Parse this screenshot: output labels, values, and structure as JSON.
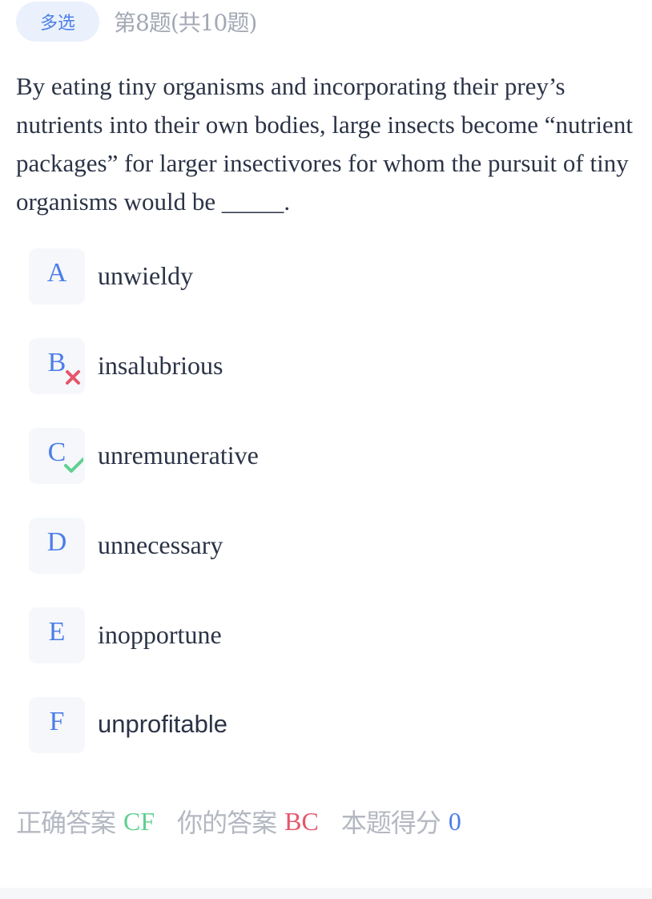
{
  "header": {
    "question_type": "多选",
    "progress": "第8题(共10题)"
  },
  "question": {
    "text": "By eating tiny organisms and incorporating their prey’s nutrients into their own bodies, large insects become “nutrient packages” for larger insectivores for whom the pursuit of tiny organisms would be _____."
  },
  "options": [
    {
      "letter": "A",
      "text": "unwieldy",
      "mark": "none"
    },
    {
      "letter": "B",
      "text": "insalubrious",
      "mark": "wrong"
    },
    {
      "letter": "C",
      "text": "unremunerative",
      "mark": "correct"
    },
    {
      "letter": "D",
      "text": "unnecessary",
      "mark": "none"
    },
    {
      "letter": "E",
      "text": "inopportune",
      "mark": "none"
    },
    {
      "letter": "F",
      "text": "unprofitable",
      "mark": "none"
    }
  ],
  "result": {
    "correct_label": "正确答案",
    "correct_value": "CF",
    "yours_label": "你的答案",
    "yours_value": "BC",
    "score_label": "本题得分",
    "score_value": "0"
  },
  "colors": {
    "accent": "#4d7ee8",
    "correct": "#5fd090",
    "wrong": "#e5566a"
  }
}
